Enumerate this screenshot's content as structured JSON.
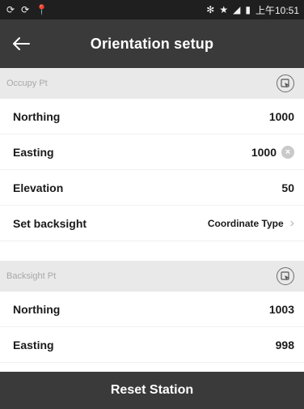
{
  "status_bar": {
    "left_icons": [
      "sync-icon",
      "sync-icon",
      "location-pin-icon"
    ],
    "right_icons": [
      "bluetooth-icon",
      "star-icon",
      "signal-icon",
      "battery-icon"
    ],
    "time": "上午10:51"
  },
  "app_bar": {
    "title": "Orientation setup",
    "back_icon": "arrow-left-icon"
  },
  "occupy_section": {
    "header": "Occupy Pt",
    "pick_icon": "pick-point-icon",
    "rows": [
      {
        "label": "Northing",
        "value": "1000"
      },
      {
        "label": "Easting",
        "value": "1000",
        "has_clear": true
      },
      {
        "label": "Elevation",
        "value": "50"
      },
      {
        "label": "Set backsight",
        "value": "Coordinate Type",
        "has_chevron": true
      }
    ]
  },
  "backsight_section": {
    "header": "Backsight Pt",
    "pick_icon": "pick-point-icon",
    "rows": [
      {
        "label": "Northing",
        "value": "1003"
      },
      {
        "label": "Easting",
        "value": "998"
      }
    ]
  },
  "bottom_button": {
    "label": "Reset Station"
  },
  "colors": {
    "app_bar": "#3a3a3a",
    "status_bar": "#1f1f1f",
    "section_header": "#e9e9e9",
    "section_text": "#a8a8a8"
  }
}
